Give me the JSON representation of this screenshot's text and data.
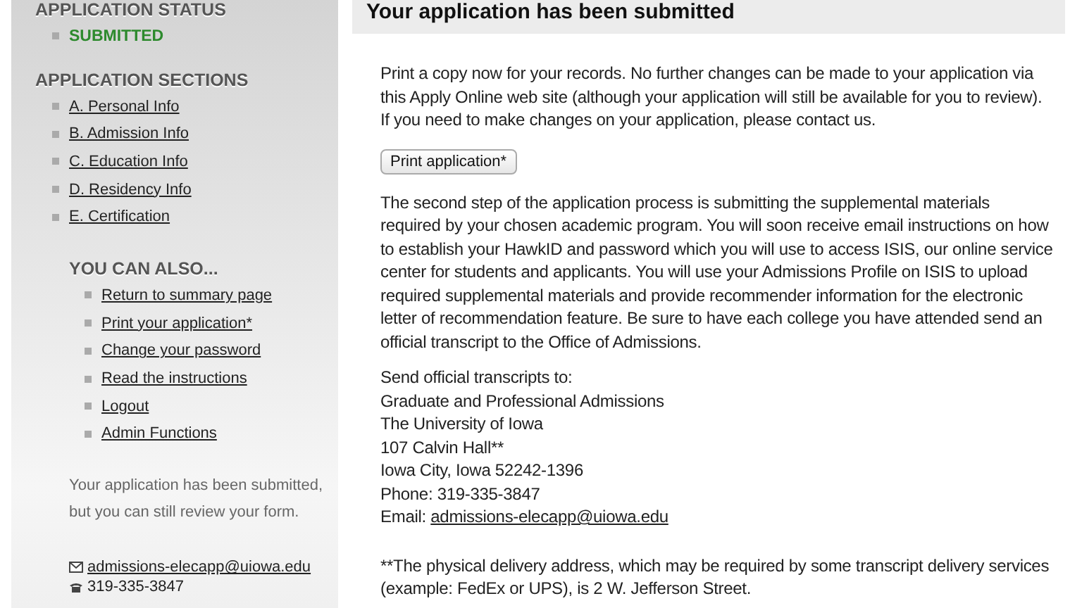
{
  "sidebar": {
    "status": {
      "heading": "APPLICATION STATUS",
      "value": "SUBMITTED"
    },
    "sections": {
      "heading": "APPLICATION SECTIONS",
      "items": [
        "A. Personal Info",
        "B. Admission Info",
        "C. Education Info",
        "D. Residency Info",
        "E. Certification"
      ]
    },
    "also": {
      "heading": "YOU CAN ALSO...",
      "items": [
        "Return to summary page",
        "Print your application*",
        "Change your password",
        "Read the instructions",
        "Logout",
        "Admin Functions"
      ]
    },
    "note": "Your application has been submitted, but you can still review your form.",
    "contact": {
      "email": "admissions-elecapp@uiowa.edu",
      "phone": "319-335-3847"
    }
  },
  "main": {
    "title": "Your application has been submitted",
    "intro": "Print a copy now for your records. No further changes can be made to your application via this Apply Online web site (although your application will still be available for you to review). If you need to make changes on your application, please contact us.",
    "print_button": "Print application*",
    "second_step": "The second step of the application process is submitting the supplemental materials required by your chosen academic program. You will soon receive email instructions on how to establish your HawkID and password which you will use to access ISIS, our online service center for students and applicants. You will use your Admissions Profile on ISIS to upload required supplemental materials and provide recommender information for the electronic letter of recommendation feature. Be sure to have each college you have attended send an official transcript to the Office of Admissions.",
    "address": {
      "lines": [
        "Send official transcripts to:",
        "Graduate and Professional Admissions",
        "The University of Iowa",
        "107 Calvin Hall**",
        "Iowa City, Iowa 52242-1396",
        "Phone: 319-335-3847"
      ],
      "email_label": "Email:",
      "email": "admissions-elecapp@uiowa.edu"
    },
    "footnote": "**The physical delivery address, which may be required by some transcript delivery services (example: FedEx or UPS), is 2 W. Jefferson Street."
  }
}
